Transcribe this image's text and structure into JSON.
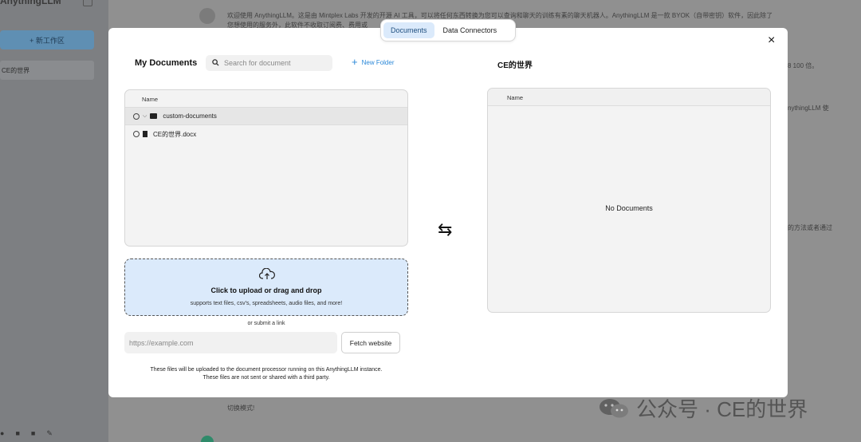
{
  "background": {
    "app_name": "AnythingLLM",
    "new_workspace_label": "+ 新工作区",
    "workspace_item": "CE的世界",
    "chat_line_1": "欢迎使用 AnythingLLM。这是由 Mintplex Labs 开发的开源 AI 工具，可以将任何东西转换为您可以查询和聊天的训练有素的聊天机器人。AnythingLLM 是一款 BYOK（自带密钥）软件，因此除了",
    "chat_line_2": "您想使用的服务外，此软件不收取订阅费、费用或",
    "side_text_1": "8 100 倍。",
    "side_text_2": "nythingLLM 使",
    "side_text_3": "的方法或者通过",
    "side_text_4": "切换模式!"
  },
  "modal": {
    "tabs": [
      {
        "label": "Documents",
        "active": true
      },
      {
        "label": "Data Connectors",
        "active": false
      }
    ],
    "close_label": "×",
    "left": {
      "title": "My Documents",
      "search_placeholder": "Search for document",
      "new_folder_label": "New Folder",
      "column_header": "Name",
      "rows": [
        {
          "name": "custom-documents",
          "type": "folder"
        },
        {
          "name": "CE的世界.docx",
          "type": "file"
        }
      ],
      "upload_title": "Click to upload or drag and drop",
      "upload_subtitle": "supports text files, csv's, spreadsheets, audio files, and more!",
      "or_link": "or submit a link",
      "url_placeholder": "https://example.com",
      "fetch_label": "Fetch website",
      "notice_line_1": "These files will be uploaded to the document processor running on this AnythingLLM instance.",
      "notice_line_2": "These files are not sent or shared with a third party."
    },
    "swap_icon": "⇆",
    "right": {
      "title": "CE的世界",
      "column_header": "Name",
      "empty_text": "No Documents"
    }
  },
  "watermark": {
    "text": "公众号 · CE的世界"
  }
}
